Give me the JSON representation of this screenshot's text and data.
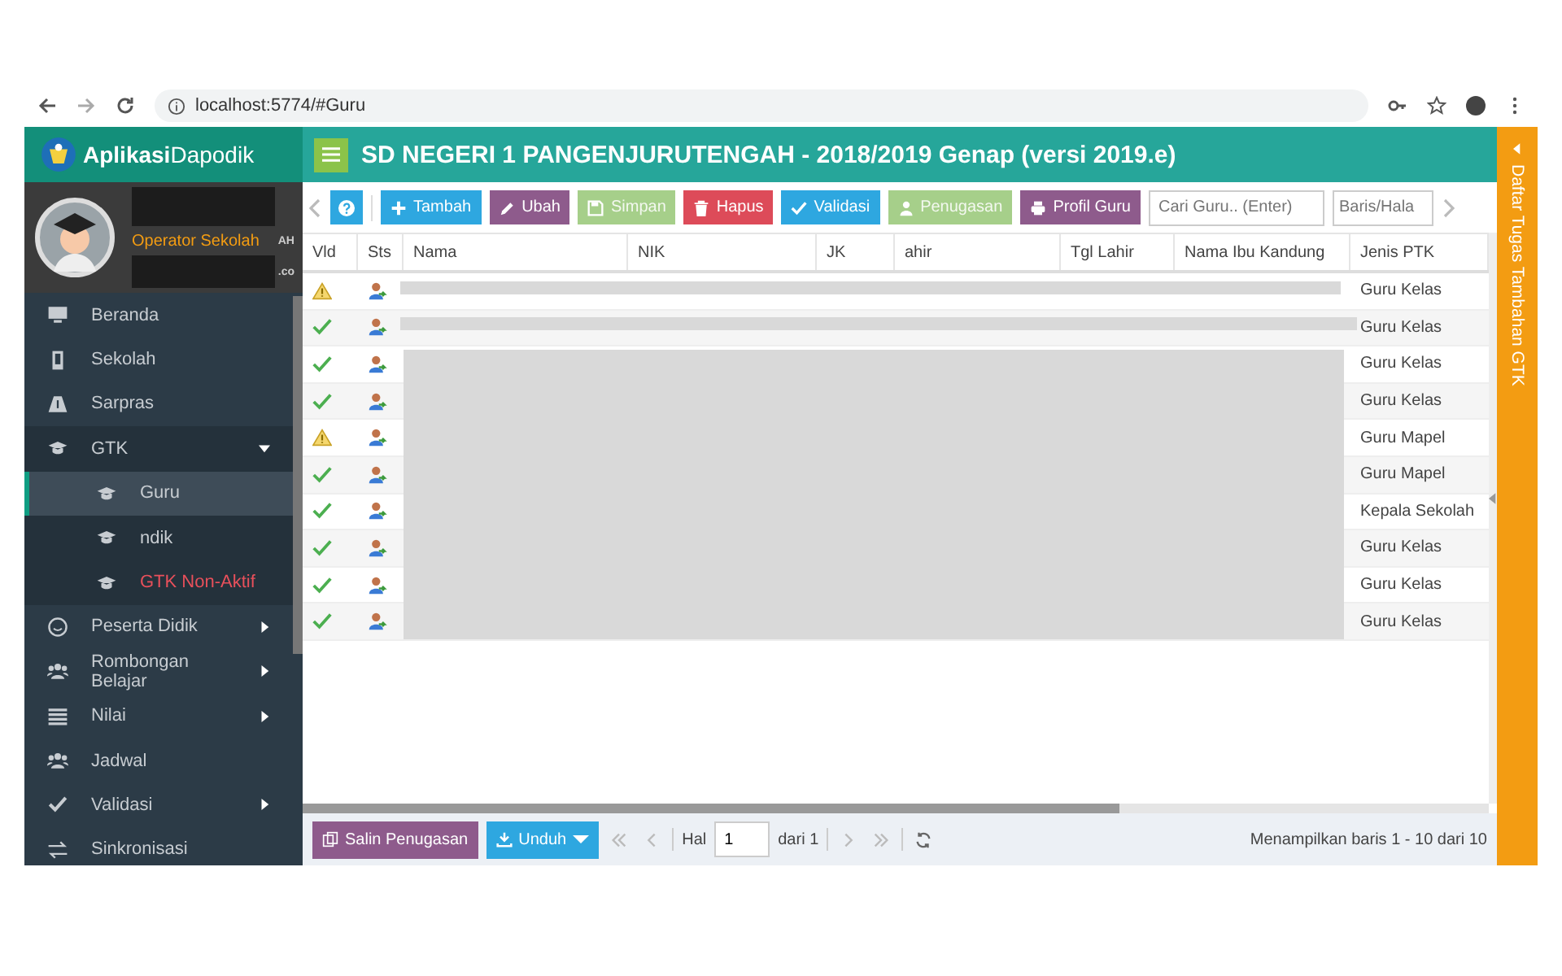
{
  "browser": {
    "url": "localhost:5774/#Guru"
  },
  "app": {
    "brand_bold": "Aplikasi",
    "brand": "Dapodik",
    "title": "SD NEGERI 1 PANGENJURUTENGAH - 2018/2019 Genap (versi 2019.e)"
  },
  "profile": {
    "fragment_1": "AH",
    "role": "Operator Sekolah",
    "fragment_2": ".co"
  },
  "sidebar": {
    "items": [
      {
        "label": "Beranda",
        "selected": false
      },
      {
        "label": "Sekolah",
        "selected": false
      },
      {
        "label": "Sarpras",
        "selected": false
      },
      {
        "label": "GTK",
        "selected": false,
        "expanded": true,
        "children": [
          {
            "label": "Guru",
            "selected": true
          },
          {
            "label": "ndik",
            "selected": false
          },
          {
            "label": "GTK Non-Aktif",
            "selected": false,
            "color": "#e8505b"
          }
        ]
      },
      {
        "label": "Peserta Didik",
        "selected": false,
        "expanded": false
      },
      {
        "label": "Rombongan Belajar",
        "selected": false,
        "expanded": false
      },
      {
        "label": "Nilai",
        "selected": false,
        "expanded": false
      },
      {
        "label": "Jadwal",
        "selected": false
      },
      {
        "label": "Validasi",
        "selected": false,
        "expanded": false
      },
      {
        "label": "Sinkronisasi",
        "selected": false
      }
    ]
  },
  "toolbar": {
    "buttons": [
      {
        "label": "Tambah",
        "color": "#2ea7e0",
        "disabled": false
      },
      {
        "label": "Ubah",
        "color": "#8e5b8c",
        "disabled": false
      },
      {
        "label": "Simpan",
        "color": "#a6cf8a",
        "disabled": true
      },
      {
        "label": "Hapus",
        "color": "#dd4b59",
        "disabled": false
      },
      {
        "label": "Validasi",
        "color": "#2ea7e0",
        "disabled": false
      },
      {
        "label": "Penugasan",
        "color": "#a6cf8a",
        "disabled": true
      },
      {
        "label": "Profil Guru",
        "color": "#8e5b8c",
        "disabled": false
      }
    ],
    "search": {
      "placeholder": "Cari Guru.. (Enter)"
    },
    "rows_field": {
      "placeholder": "Baris/Hala"
    }
  },
  "table": {
    "columns": [
      "Vld",
      "Sts",
      "Nama",
      "NIK",
      "JK",
      "ahir",
      "Tgl Lahir",
      "Nama Ibu Kandung",
      "Jenis PTK"
    ],
    "rows": [
      {
        "valid": false,
        "jenis_ptk": "Guru Kelas"
      },
      {
        "valid": true,
        "jenis_ptk": "Guru Kelas"
      },
      {
        "valid": true,
        "jenis_ptk": "Guru Kelas"
      },
      {
        "valid": true,
        "jenis_ptk": "Guru Kelas"
      },
      {
        "valid": false,
        "jenis_ptk": "Guru Mapel"
      },
      {
        "valid": true,
        "jenis_ptk": "Guru Mapel"
      },
      {
        "valid": true,
        "jenis_ptk": "Kepala Sekolah"
      },
      {
        "valid": true,
        "jenis_ptk": "Guru Kelas"
      },
      {
        "valid": true,
        "jenis_ptk": "Guru Kelas"
      },
      {
        "valid": true,
        "jenis_ptk": "Guru Kelas"
      }
    ]
  },
  "footer": {
    "copy_button": "Salin Penugasan",
    "download_button": "Unduh",
    "page_label": "Hal",
    "page": "1",
    "page_of": "dari 1",
    "info": "Menampilkan baris 1 - 10 dari 10"
  },
  "side_panel": {
    "title": "Daftar Tugas Tambahan GTK"
  }
}
